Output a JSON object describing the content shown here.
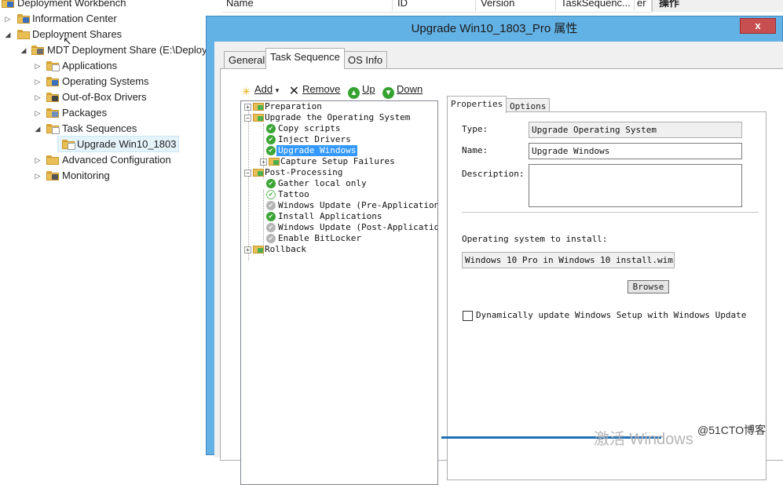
{
  "console_tree": {
    "items": [
      {
        "label": "Deployment Workbench",
        "mark": "#3a6fbf"
      },
      {
        "label": "Information Center",
        "mark": "#3a6fbf"
      },
      {
        "label": "Deployment Shares",
        "mark": null
      },
      {
        "label": "MDT Deployment Share (E:\\Deploy",
        "mark": "#6d6d6d"
      },
      {
        "label": "Applications",
        "mark": "#ffffff"
      },
      {
        "label": "Operating Systems",
        "mark": "#3a6fbf"
      },
      {
        "label": "Out-of-Box Drivers",
        "mark": "#444444"
      },
      {
        "label": "Packages",
        "mark": "#6d8fbf"
      },
      {
        "label": "Task Sequences",
        "mark": "#ffffff"
      },
      {
        "label": "Upgrade Win10_1803",
        "mark": "#ffffff"
      },
      {
        "label": "Advanced Configuration",
        "mark": null
      },
      {
        "label": "Monitoring",
        "mark": "#555555"
      }
    ]
  },
  "list_header": {
    "columns": [
      "Name",
      "ID",
      "Version",
      "TaskSequenc...",
      "er"
    ]
  },
  "actions_pane": {
    "title": "操作"
  },
  "dialog": {
    "title": "Upgrade Win10_1803_Pro 属性",
    "close": "x",
    "tabs": [
      "General",
      "Task Sequence",
      "OS Info"
    ],
    "active_tab": "Task Sequence"
  },
  "toolbar": {
    "add": "Add",
    "remove": "Remove",
    "up": "Up",
    "down": "Down"
  },
  "ts_tree": {
    "items": [
      {
        "label": "Preparation"
      },
      {
        "label": "Upgrade the Operating System"
      },
      {
        "label": "Copy scripts"
      },
      {
        "label": "Inject Drivers"
      },
      {
        "label": "Upgrade Windows"
      },
      {
        "label": "Capture Setup Failures"
      },
      {
        "label": "Post-Processing"
      },
      {
        "label": "Gather local only"
      },
      {
        "label": "Tattoo"
      },
      {
        "label": "Windows Update (Pre-Application I"
      },
      {
        "label": "Install Applications"
      },
      {
        "label": "Windows Update (Post-Application"
      },
      {
        "label": "Enable BitLocker"
      },
      {
        "label": "Rollback"
      }
    ]
  },
  "properties": {
    "tabs": [
      "Properties",
      "Options"
    ],
    "type_label": "Type:",
    "type_value": "Upgrade Operating System",
    "name_label": "Name:",
    "name_value": "Upgrade Windows",
    "description_label": "Description:",
    "description_value": "",
    "os_label": "Operating system to install:",
    "os_value": "Windows 10 Pro in Windows 10 install.wim",
    "browse": "Browse",
    "dynamic_update": "Dynamically update Windows Setup with Windows Update"
  },
  "overlay": {
    "watermark": "激活 Windows",
    "credit": "@51CTO博客"
  }
}
